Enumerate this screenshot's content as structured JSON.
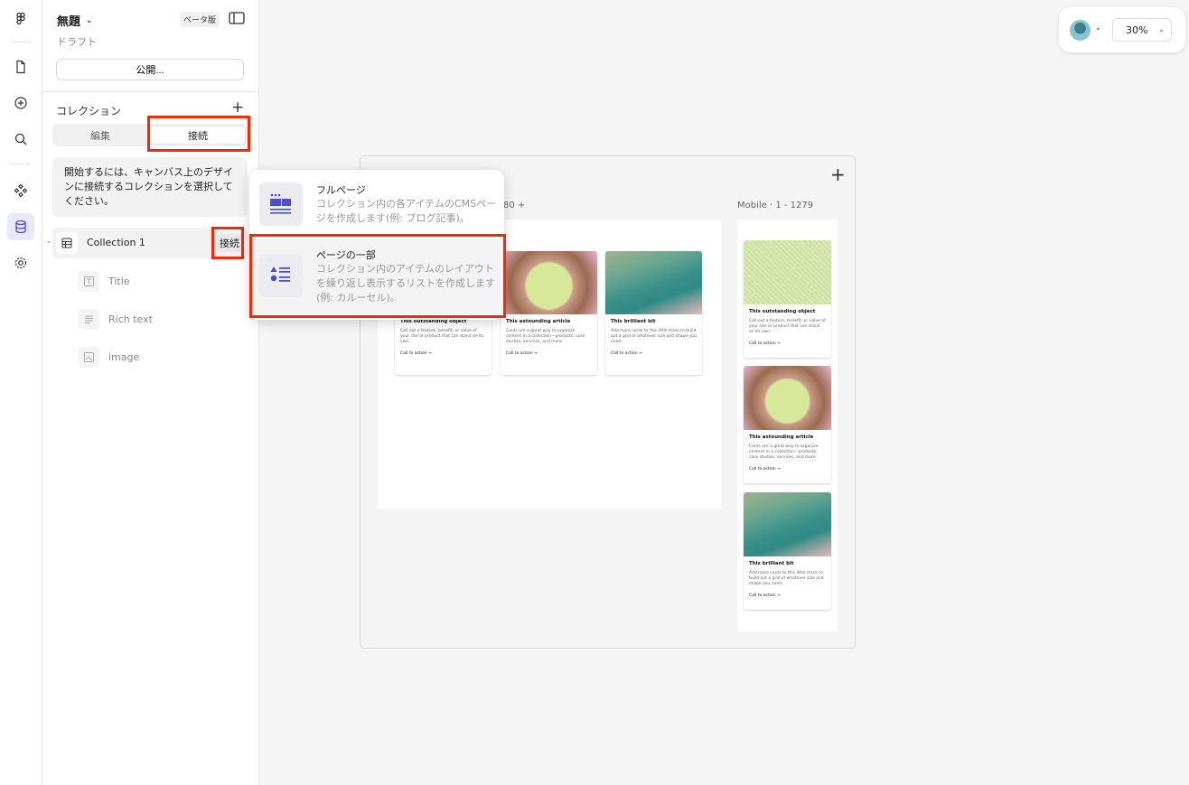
{
  "rail": {
    "icons": [
      "figma-logo-icon",
      "file-icon",
      "add-circle-icon",
      "search-icon",
      "components-icon",
      "database-icon",
      "settings-icon"
    ]
  },
  "file": {
    "title": "無題",
    "beta_badge": "ベータ版",
    "status": "ドラフト",
    "publish_label": "公開..."
  },
  "collections": {
    "heading": "コレクション",
    "tabs": [
      "編集",
      "接続"
    ],
    "selected_tab": "接続",
    "hint": "開始するには、キャンバス上のデザインに接続するコレクションを選択してください。",
    "collection_name": "Collection 1",
    "connect_label": "接続",
    "fields": [
      {
        "name": "Title",
        "icon": "text-field-icon"
      },
      {
        "name": "Rich text",
        "icon": "rich-text-icon"
      },
      {
        "name": "image",
        "icon": "image-icon"
      }
    ]
  },
  "toolbar": {
    "zoom": "30%"
  },
  "popup": {
    "items": [
      {
        "title": "フルページ",
        "description": "コレクション内の各アイテムのCMSページを作成します(例: ブログ記事)。"
      },
      {
        "title": "ページの一部",
        "description": "コレクション内のアイテムのレイアウトを繰り返し表示するリストを作成します(例: カルーセル)。"
      }
    ]
  },
  "canvas": {
    "desktop_label_partial": "80 +",
    "mobile_label": "Mobile · 1 - 1279",
    "cards": [
      {
        "title": "This outstanding object",
        "desc": "Call out a feature, benefit, or value of your site or product that can stand on its own.",
        "cta": "Call to action →"
      },
      {
        "title": "This astounding article",
        "desc": "Cards are a great way to organize content in a collection—products, case studies, services, and more.",
        "cta": "Call to action →"
      },
      {
        "title": "This brilliant bit",
        "desc": "Add more cards to this little stack to build out a grid of whatever size and shape you need.",
        "cta": "Call to action →"
      }
    ]
  },
  "highlight_color": "#ee2b0a"
}
